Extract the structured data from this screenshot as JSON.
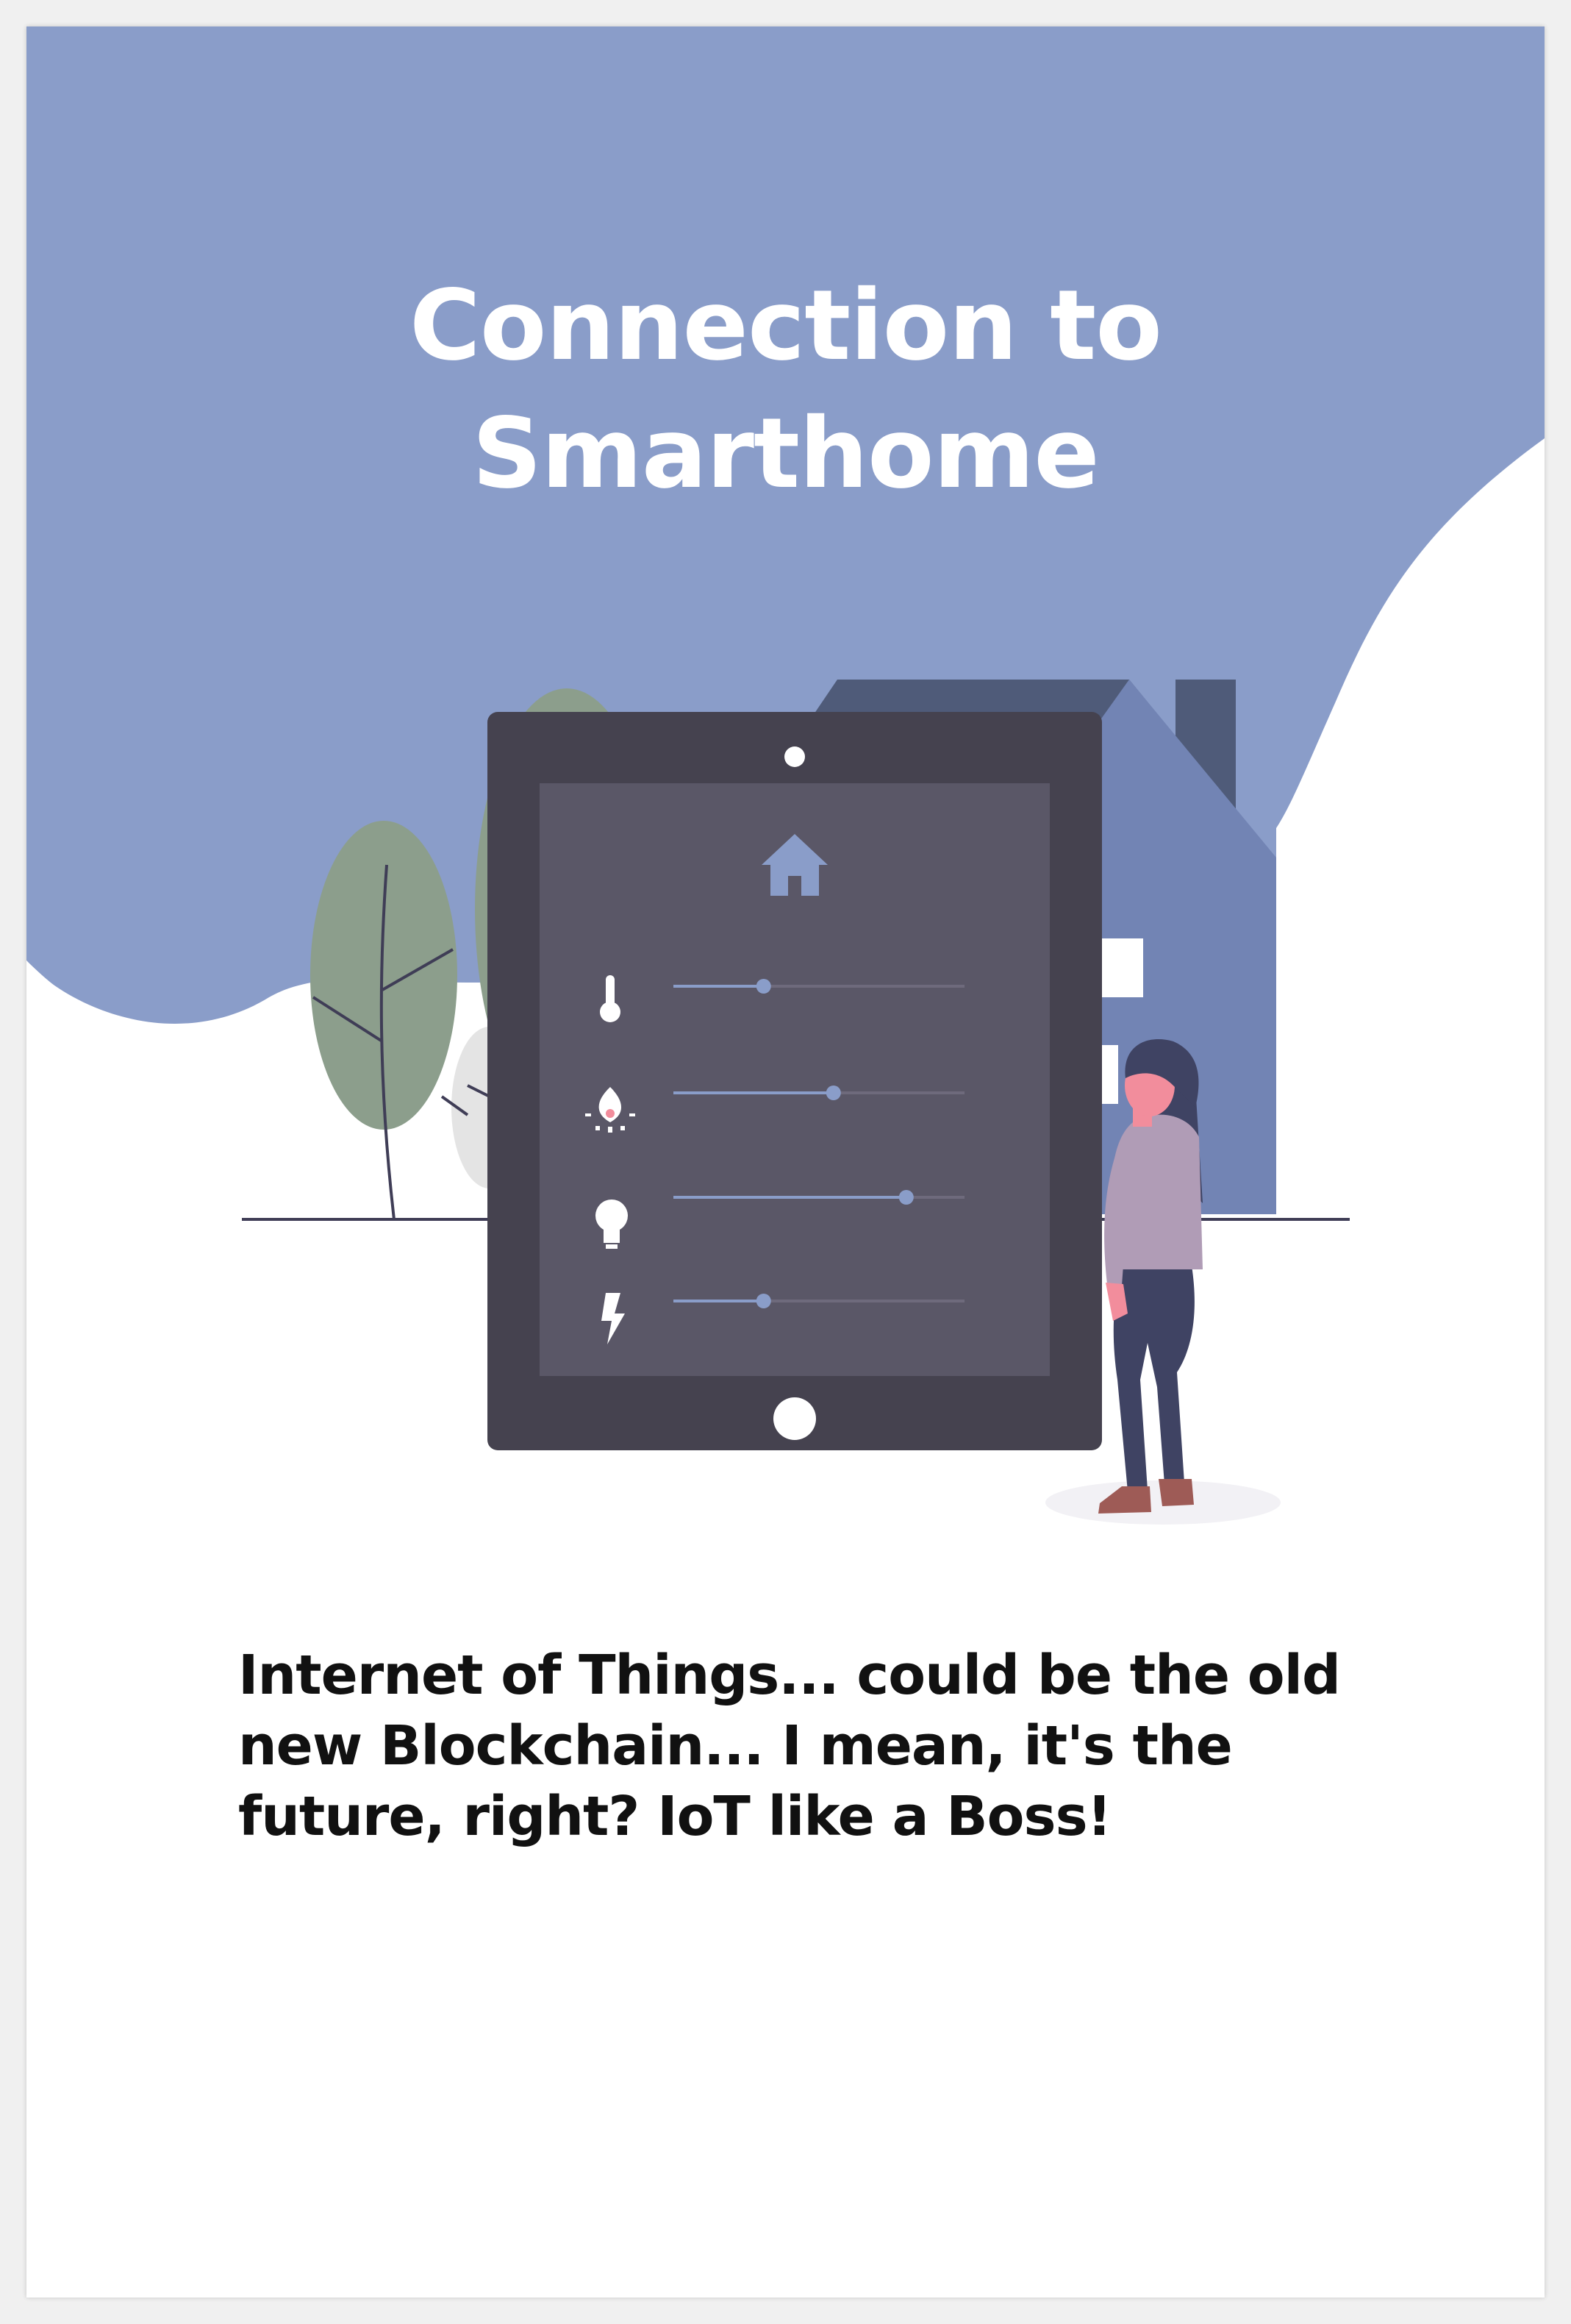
{
  "title": {
    "line1": "Connection to",
    "line2": "Smarthome"
  },
  "description": {
    "line1": "Internet of Things... could be the old",
    "line2": "new Blockchain... I mean, it's the",
    "line3": "future, right? IoT like a Boss!"
  },
  "controls": [
    {
      "icon": "thermometer-icon",
      "level": 0.31
    },
    {
      "icon": "flame-icon",
      "level": 0.55
    },
    {
      "icon": "lightbulb-icon",
      "level": 0.8
    },
    {
      "icon": "lightning-icon",
      "level": 0.31
    }
  ],
  "colors": {
    "background_wave": "#8a9dc9",
    "house_wall": "#7284b4",
    "house_roof": "#4f5b79",
    "tablet_frame": "#45424f",
    "tablet_screen": "#5a5767",
    "slider_active": "#8a9dc9",
    "tree": "#8c9e8c",
    "person_shirt": "#b09cb6",
    "person_pants": "#3f4363"
  }
}
